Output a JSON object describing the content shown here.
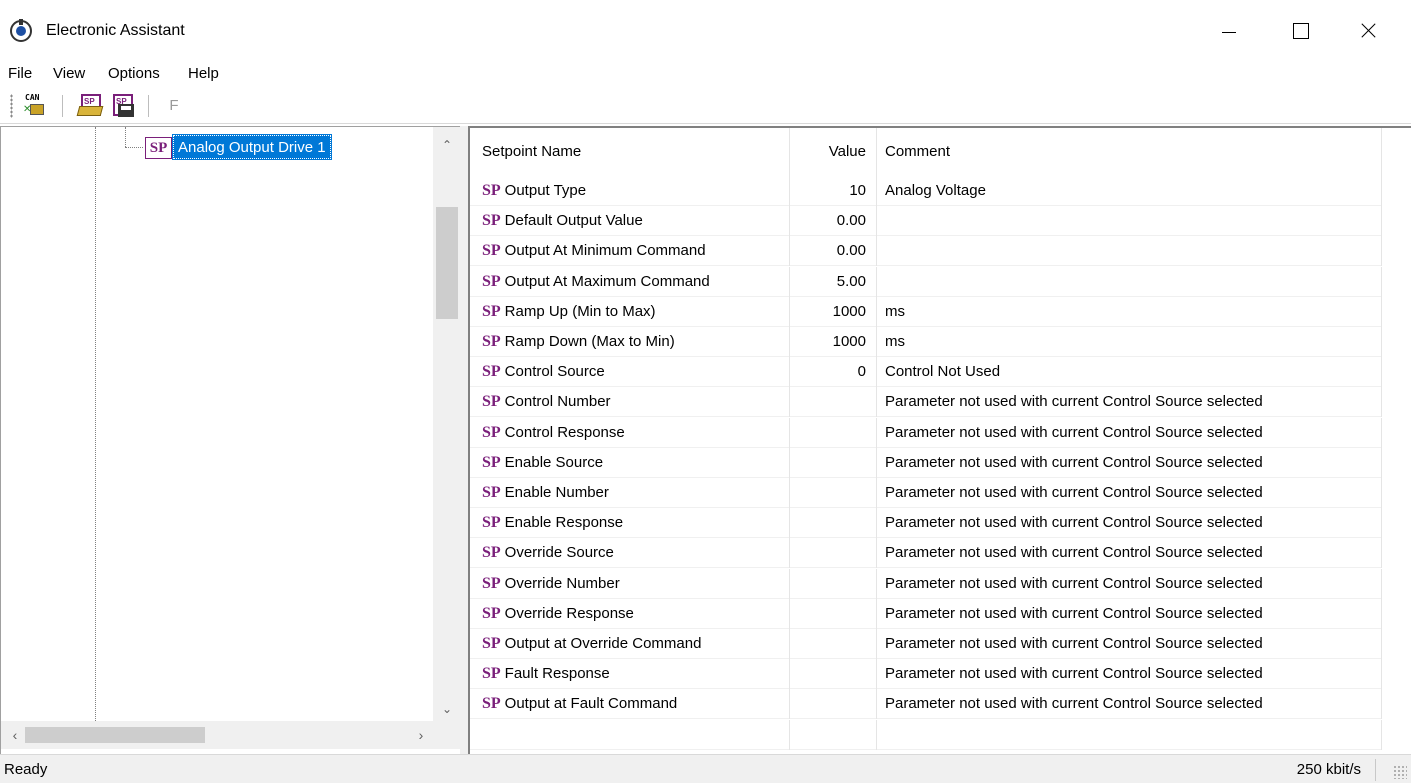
{
  "window": {
    "title": "Electronic Assistant"
  },
  "menu": {
    "items": [
      "File",
      "View",
      "Options",
      "Help"
    ]
  },
  "toolbar": {
    "can_label": "CAN",
    "open_sp_label": "SP",
    "save_sp_label": "SP",
    "f_label": "F"
  },
  "tree": {
    "selected_icon": "SP",
    "selected_label": "Analog Output Drive 1"
  },
  "table": {
    "headers": {
      "name": "Setpoint Name",
      "value": "Value",
      "comment": "Comment"
    },
    "rows": [
      {
        "tag": "SP",
        "name": "Output Type",
        "value": "10",
        "comment": "Analog Voltage"
      },
      {
        "tag": "SP",
        "name": "Default Output Value",
        "value": "0.00",
        "comment": ""
      },
      {
        "tag": "SP",
        "name": "Output At Minimum Command",
        "value": "0.00",
        "comment": ""
      },
      {
        "tag": "SP",
        "name": "Output At Maximum Command",
        "value": "5.00",
        "comment": ""
      },
      {
        "tag": "SP",
        "name": "Ramp Up (Min to Max)",
        "value": "1000",
        "comment": "ms"
      },
      {
        "tag": "SP",
        "name": "Ramp Down (Max to Min)",
        "value": "1000",
        "comment": "ms"
      },
      {
        "tag": "SP",
        "name": "Control Source",
        "value": "0",
        "comment": "Control Not Used"
      },
      {
        "tag": "SP",
        "name": "Control Number",
        "value": "",
        "comment": "Parameter not used with current Control Source selected"
      },
      {
        "tag": "SP",
        "name": "Control Response",
        "value": "",
        "comment": "Parameter not used with current Control Source selected"
      },
      {
        "tag": "SP",
        "name": "Enable Source",
        "value": "",
        "comment": "Parameter not used with current Control Source selected"
      },
      {
        "tag": "SP",
        "name": "Enable Number",
        "value": "",
        "comment": "Parameter not used with current Control Source selected"
      },
      {
        "tag": "SP",
        "name": "Enable Response",
        "value": "",
        "comment": "Parameter not used with current Control Source selected"
      },
      {
        "tag": "SP",
        "name": "Override Source",
        "value": "",
        "comment": "Parameter not used with current Control Source selected"
      },
      {
        "tag": "SP",
        "name": "Override Number",
        "value": "",
        "comment": "Parameter not used with current Control Source selected"
      },
      {
        "tag": "SP",
        "name": "Override Response",
        "value": "",
        "comment": "Parameter not used with current Control Source selected"
      },
      {
        "tag": "SP",
        "name": "Output at Override Command",
        "value": "",
        "comment": "Parameter not used with current Control Source selected"
      },
      {
        "tag": "SP",
        "name": "Fault Response",
        "value": "",
        "comment": "Parameter not used with current Control Source selected"
      },
      {
        "tag": "SP",
        "name": "Output at Fault Command",
        "value": "",
        "comment": "Parameter not used with current Control Source selected"
      }
    ]
  },
  "status": {
    "left": "Ready",
    "right": "250 kbit/s"
  },
  "icons": {
    "app": "app-icon",
    "minimize": "minimize-icon",
    "maximize": "maximize-icon",
    "close": "close-icon",
    "scroll_up": "chevron-up-icon",
    "scroll_down": "chevron-down-icon",
    "scroll_left": "chevron-left-icon",
    "scroll_right": "chevron-right-icon"
  },
  "colors": {
    "selection": "#0078d7",
    "sp_tag": "#7a1f7a"
  }
}
